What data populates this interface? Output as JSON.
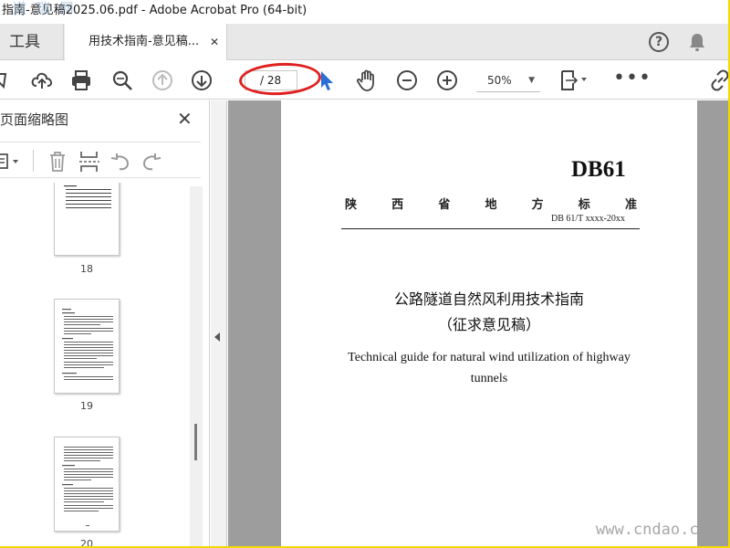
{
  "window": {
    "title": "指南-意见稿2025.06.pdf - Adobe Acrobat Pro (64-bit)",
    "watermark_top": "道 瑞 网"
  },
  "tabs": {
    "tools_label": "工具",
    "doc_label": "用技术指南-意见稿...",
    "close_glyph": "✕"
  },
  "header_icons": {
    "help": "help-icon",
    "bell": "bell-icon"
  },
  "toolbar": {
    "page_field": "/ 28",
    "zoom": "50%",
    "zoom_caret": "▼",
    "more": "•••",
    "icons": [
      "bookmark-icon",
      "upload-icon",
      "print-icon",
      "zoom-search-icon",
      "page-up-icon",
      "page-down-icon",
      "select-cursor-icon",
      "hand-tool-icon",
      "zoom-out-icon",
      "zoom-in-icon",
      "fit-page-icon",
      "link-icon"
    ]
  },
  "sidepanel": {
    "title": "页面缩略图",
    "close": "✕",
    "tool_icons": [
      "options-icon",
      "delete-icon",
      "extract-icon",
      "undo-icon",
      "redo-icon"
    ],
    "thumbnails": [
      {
        "label": "18"
      },
      {
        "label": "19"
      },
      {
        "label": "20"
      }
    ]
  },
  "document": {
    "std_code": "DB61",
    "province_chars": [
      "陕",
      "西",
      "省",
      "地",
      "方",
      "标",
      "准"
    ],
    "std_number": "DB 61/T xxxx-20xx",
    "title_cn": "公路隧道自然风利用技术指南",
    "subtitle_cn": "（征求意见稿）",
    "title_en": "Technical guide for natural wind utilization of highway tunnels"
  },
  "watermark_bottom": "www.cndao.c",
  "colors": {
    "frame": "#f5d900",
    "annotation_red": "#e02020",
    "cursor_blue": "#2a6fd6",
    "doc_background": "#9d9d9d"
  }
}
